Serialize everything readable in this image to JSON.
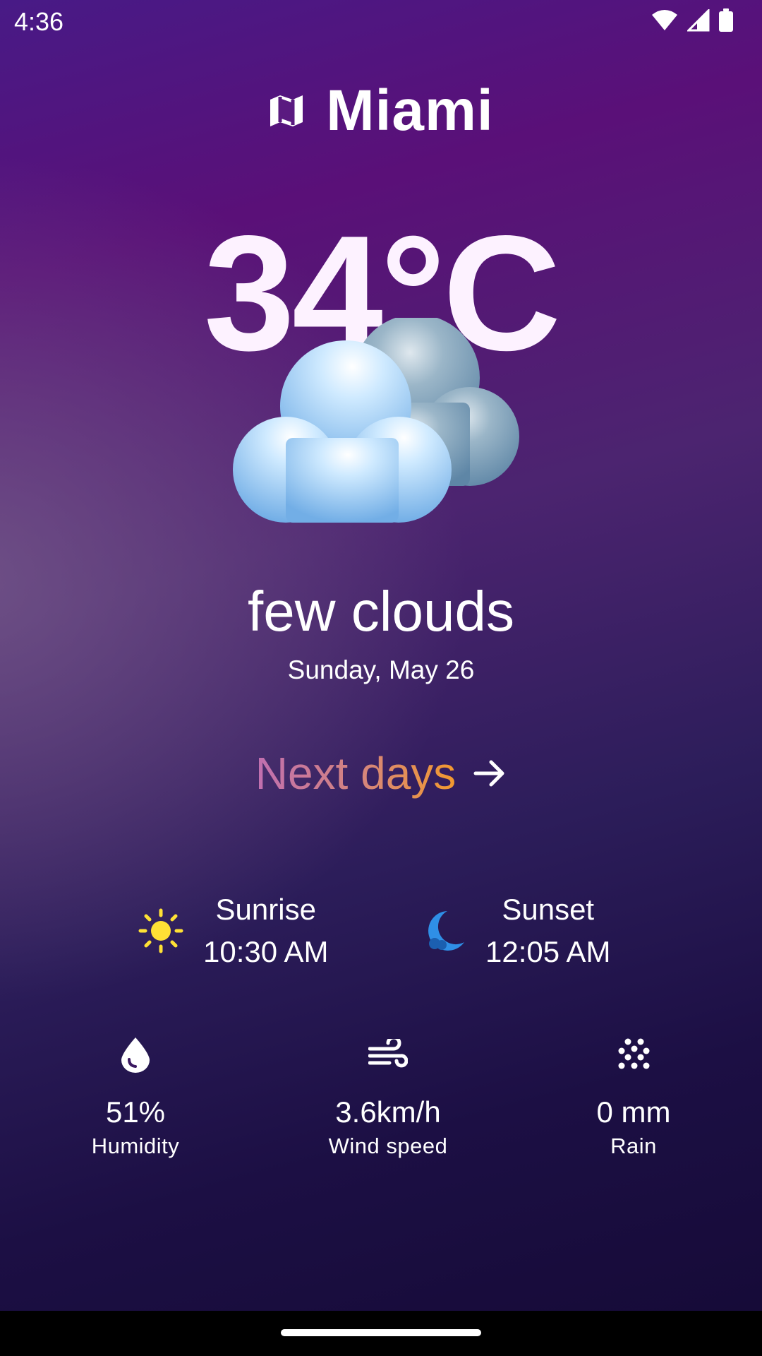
{
  "status_bar": {
    "time": "4:36",
    "icons": [
      "wifi-icon",
      "signal-icon",
      "battery-icon"
    ]
  },
  "header": {
    "city": "Miami",
    "icon": "map-icon"
  },
  "current": {
    "temperature": "34°C",
    "icon": "few-clouds-icon",
    "description": "few clouds",
    "date": "Sunday, May 26"
  },
  "next_days": {
    "label": "Next days",
    "icon": "arrow-right-icon"
  },
  "sun": {
    "sunrise_label": "Sunrise",
    "sunrise_time": "10:30 AM",
    "sunrise_icon": "sun-icon",
    "sunset_label": "Sunset",
    "sunset_time": "12:05 AM",
    "sunset_icon": "moon-icon"
  },
  "stats": {
    "humidity": {
      "value": "51%",
      "label": "Humidity",
      "icon": "water-drop-icon"
    },
    "wind": {
      "value": "3.6km/h",
      "label": "Wind speed",
      "icon": "wind-icon"
    },
    "rain": {
      "value": "0 mm",
      "label": "Rain",
      "icon": "rain-dots-icon"
    }
  },
  "colors": {
    "sun_icon": "#ffe135",
    "moon_icon": "#2f8fe6",
    "next_days_gradient": [
      "#c06fb1",
      "#f39a2e"
    ]
  }
}
